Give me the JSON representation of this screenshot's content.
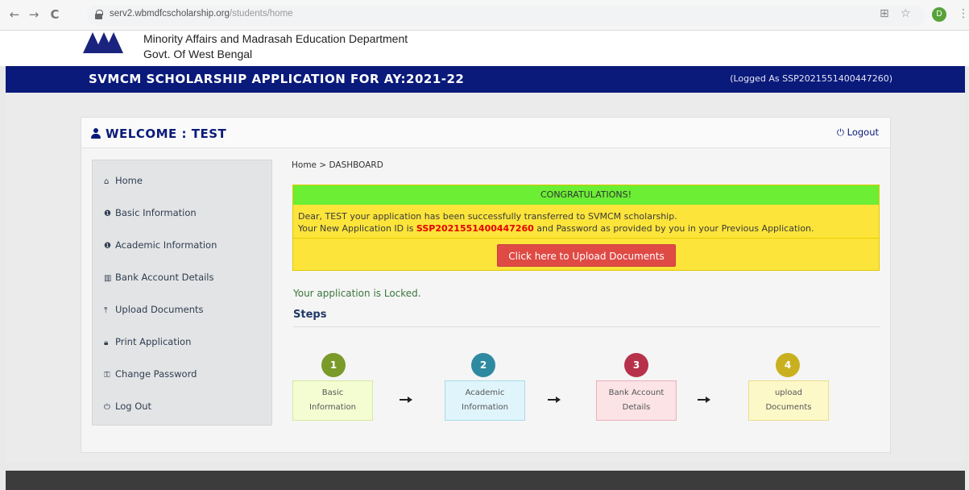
{
  "browser": {
    "back_icon": "←",
    "forward_icon": "→",
    "reload_icon": "C",
    "url_host": "serv2.wbmdfcscholarship.org",
    "url_path": "/students/home",
    "profile_letter": "D"
  },
  "header": {
    "dept_line1": "Minority Affairs and Madrasah Education Department",
    "dept_line2": "Govt. Of West Bengal"
  },
  "banner": {
    "title": "SVMCM SCHOLARSHIP APPLICATION FOR AY:2021-22",
    "logged_as": "(Logged As SSP2021551400447260)"
  },
  "panel": {
    "welcome": "WELCOME : TEST",
    "logout": "Logout"
  },
  "sidebar": {
    "items": [
      {
        "label": "Home",
        "icon": "home-icon"
      },
      {
        "label": "Basic Information",
        "icon": "info-icon"
      },
      {
        "label": "Academic Information",
        "icon": "info-icon"
      },
      {
        "label": "Bank Account Details",
        "icon": "bank-icon"
      },
      {
        "label": "Upload Documents",
        "icon": "upload-icon"
      },
      {
        "label": "Print Application",
        "icon": "lock-icon"
      },
      {
        "label": "Change Password",
        "icon": "key-icon"
      },
      {
        "label": "Log Out",
        "icon": "power-icon"
      }
    ]
  },
  "main": {
    "breadcrumb": "Home > DASHBOARD",
    "alert": {
      "heading": "CONGRATULATIONS!",
      "line1": "Dear, TEST your application has been successfully transferred to SVMCM scholarship.",
      "line2_prefix": "Your New Application ID is ",
      "application_id": "SSP2021551400447260",
      "line2_suffix": " and Password as provided by you in your Previous Application.",
      "upload_button": "Click here to Upload Documents"
    },
    "locked_text": "Your application is Locked.",
    "steps_title": "Steps",
    "steps": [
      {
        "number": "1",
        "line1": "Basic",
        "line2": "Information",
        "circle_color": "#7a9a2a",
        "box_bg": "#f4fcd2",
        "box_border": "#d4e7a0"
      },
      {
        "number": "2",
        "line1": "Academic",
        "line2": "Information",
        "circle_color": "#2e8aa0",
        "box_bg": "#dff5fb",
        "box_border": "#a8dbe8"
      },
      {
        "number": "3",
        "line1": "Bank Account",
        "line2": "Details",
        "circle_color": "#b8314a",
        "box_bg": "#fbe3e6",
        "box_border": "#eab0ba"
      },
      {
        "number": "4",
        "line1": "upload",
        "line2": "Documents",
        "circle_color": "#c9b020",
        "box_bg": "#fdf8c8",
        "box_border": "#e8de8c"
      }
    ]
  }
}
